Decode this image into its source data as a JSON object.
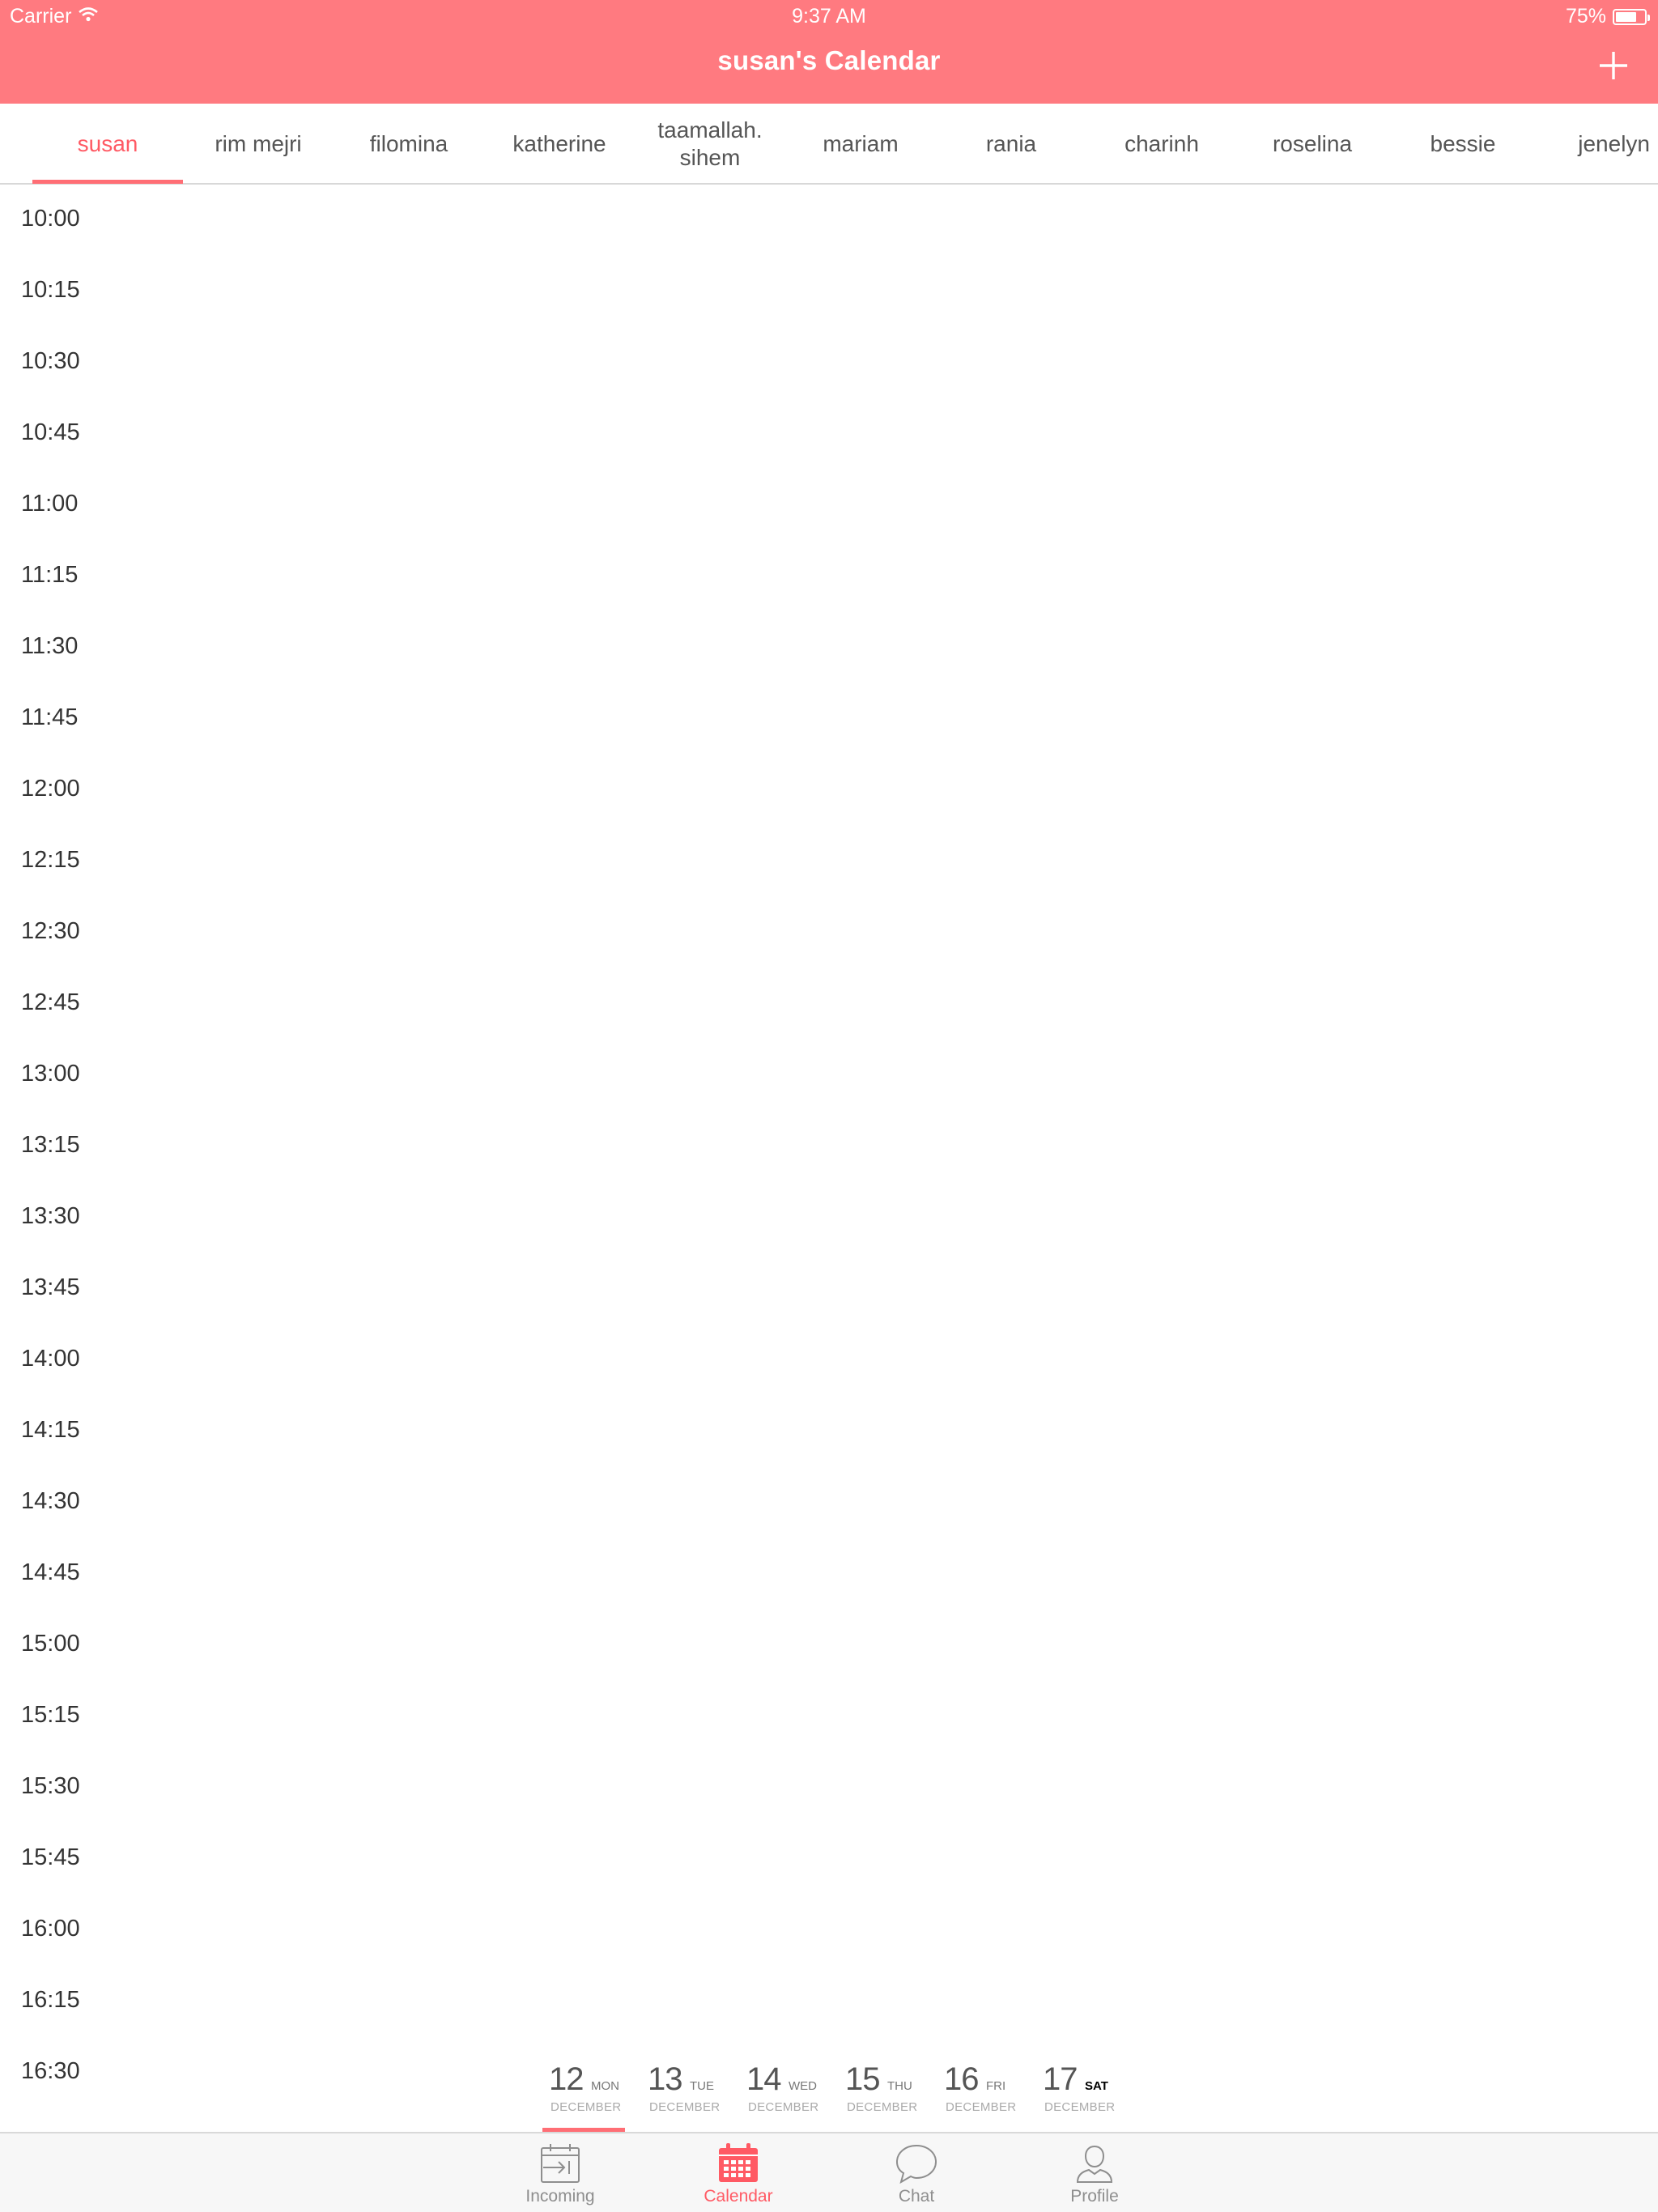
{
  "status_bar": {
    "carrier": "Carrier",
    "time": "9:37 AM",
    "battery": "75%",
    "battery_level": 0.75
  },
  "nav": {
    "title": "susan's Calendar",
    "add_icon": "plus-icon"
  },
  "staff_tabs": [
    {
      "label": "susan",
      "active": true
    },
    {
      "label": "rim mejri"
    },
    {
      "label": "filomina"
    },
    {
      "label": "katherine"
    },
    {
      "label": "taamallah. sihem"
    },
    {
      "label": "mariam"
    },
    {
      "label": "rania"
    },
    {
      "label": "charinh"
    },
    {
      "label": "roselina"
    },
    {
      "label": "bessie"
    },
    {
      "label": "jenelyn"
    }
  ],
  "time_slots": [
    "10:00",
    "10:15",
    "10:30",
    "10:45",
    "11:00",
    "11:15",
    "11:30",
    "11:45",
    "12:00",
    "12:15",
    "12:30",
    "12:45",
    "13:00",
    "13:15",
    "13:30",
    "13:45",
    "14:00",
    "14:15",
    "14:30",
    "14:45",
    "15:00",
    "15:15",
    "15:30",
    "15:45",
    "16:00",
    "16:15",
    "16:30"
  ],
  "days": [
    {
      "num": "12",
      "weekday": "MON",
      "month": "DECEMBER",
      "selected": true
    },
    {
      "num": "13",
      "weekday": "TUE",
      "month": "DECEMBER"
    },
    {
      "num": "14",
      "weekday": "WED",
      "month": "DECEMBER"
    },
    {
      "num": "15",
      "weekday": "THU",
      "month": "DECEMBER"
    },
    {
      "num": "16",
      "weekday": "FRI",
      "month": "DECEMBER"
    },
    {
      "num": "17",
      "weekday": "SAT",
      "month": "DECEMBER",
      "today": true
    }
  ],
  "tabbar": [
    {
      "label": "Incoming",
      "icon": "incoming-icon"
    },
    {
      "label": "Calendar",
      "icon": "calendar-icon",
      "active": true
    },
    {
      "label": "Chat",
      "icon": "chat-icon"
    },
    {
      "label": "Profile",
      "icon": "profile-icon"
    }
  ],
  "colors": {
    "accent": "#ff7a80",
    "active_text": "#ff5a64",
    "underline": "#ff6e75"
  }
}
